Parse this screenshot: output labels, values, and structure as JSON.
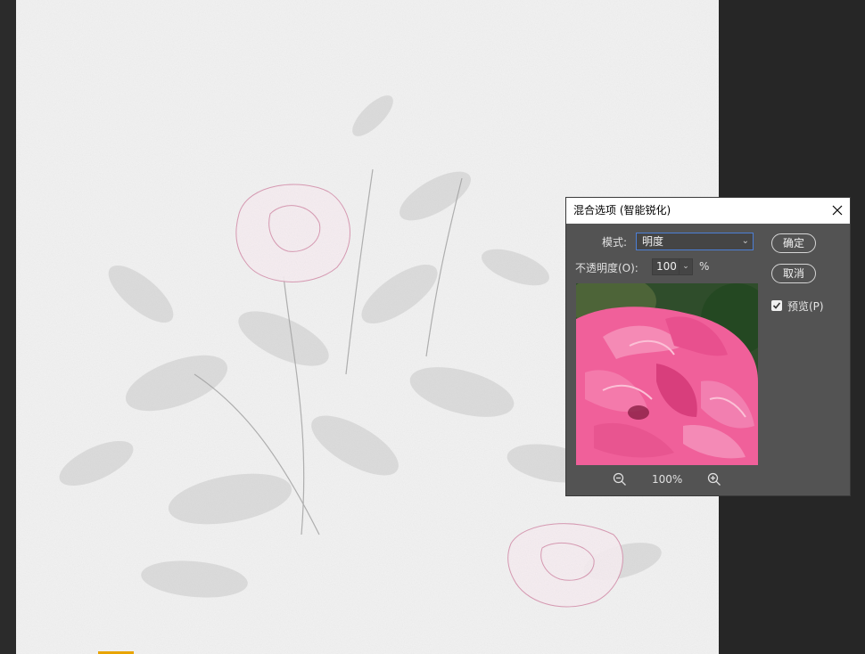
{
  "dialog": {
    "title": "混合选项 (智能锐化)",
    "mode_label": "模式:",
    "mode_value": "明度",
    "opacity_label": "不透明度(O):",
    "opacity_value": "100",
    "opacity_unit": "%",
    "ok_label": "确定",
    "cancel_label": "取消",
    "preview_label": "预览(P)",
    "preview_checked": true,
    "zoom_level": "100%"
  },
  "icons": {
    "close": "close-icon",
    "zoom_out": "zoom-out-icon",
    "zoom_in": "zoom-in-icon",
    "dropdown": "chevron-down-icon",
    "check": "check-icon"
  },
  "colors": {
    "workspace": "#262626",
    "dialog_bg": "#535353",
    "focus_border": "#4c7fd6",
    "rose_pink": "#f0609a"
  }
}
